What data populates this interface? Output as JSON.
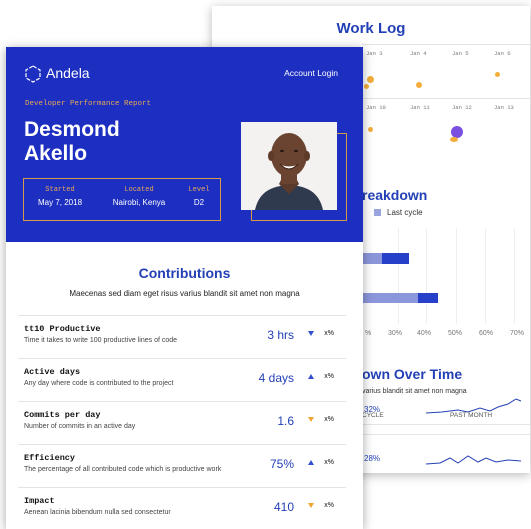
{
  "worklog": {
    "title": "Work Log",
    "dates_row1": [
      "Jan 3",
      "Jan 4",
      "Jan 5",
      "Jan 6"
    ],
    "dates_row2": [
      "Jan 10",
      "Jan 11",
      "Jan 12",
      "Jan 13"
    ]
  },
  "breakdown": {
    "title": "reakdown",
    "legend_label": "Last cycle",
    "x_ticks": [
      "%",
      "30%",
      "40%",
      "50%",
      "60%",
      "70%"
    ]
  },
  "over_time": {
    "title": "own Over Time",
    "subtitle": "varius blandit sit amet non magna",
    "col_cycle": "CYCLE",
    "col_past": "PAST MONTH",
    "rows": [
      "32%",
      "28%"
    ]
  },
  "header": {
    "logo_text": "Andela",
    "account_login": "Account Login",
    "eyebrow": "Developer Performance Report",
    "first_name": "Desmond",
    "last_name": "Akello",
    "info": [
      {
        "label": "Started",
        "value": "May 7, 2018"
      },
      {
        "label": "Located",
        "value": "Nairobi, Kenya"
      },
      {
        "label": "Level",
        "value": "D2"
      }
    ]
  },
  "contributions": {
    "title": "Contributions",
    "subtitle": "Maecenas sed diam eget risus varius blandit sit amet non magna",
    "metrics": [
      {
        "name": "tt10 Productive",
        "desc": "Time it takes to write 100 productive lines of code",
        "value": "3 hrs",
        "delta": "x%",
        "trend": "down"
      },
      {
        "name": "Active days",
        "desc": "Any day where code is contributed to the project",
        "value": "4 days",
        "delta": "x%",
        "trend": "up"
      },
      {
        "name": "Commits per day",
        "desc": "Number of commits in an active day",
        "value": "1.6",
        "delta": "x%",
        "trend": "down"
      },
      {
        "name": "Efficiency",
        "desc": "The percentage of all contributed code which is productive work",
        "value": "75%",
        "delta": "x%",
        "trend": "up"
      },
      {
        "name": "Impact",
        "desc": "Aenean lacinia bibendum nulla sed consectetur",
        "value": "410",
        "delta": "x%",
        "trend": "down"
      }
    ]
  },
  "colors": {
    "brand_blue": "#1c2fc0",
    "accent_orange": "#e8a856",
    "title_blue": "#2340b5"
  }
}
